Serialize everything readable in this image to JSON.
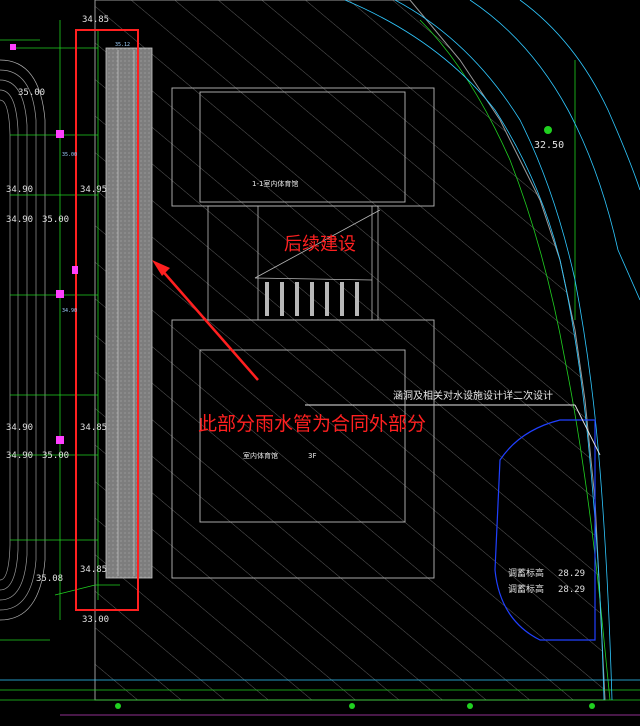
{
  "annotations": {
    "red_note": "此部分雨水管为合同外部分",
    "future_build": "后续建设",
    "culvert_note": "涵洞及相关对水设施设计详二次设计"
  },
  "building_labels": {
    "upper": "1-1室内体育馆",
    "lower": "室内体育馆",
    "floors": "3F"
  },
  "elevations": {
    "track_top_left": "35.00",
    "left_a": "34.90",
    "left_b": "35.00",
    "left_c": "34.90",
    "left_d": "35.00",
    "left_e": "35.00",
    "strip_top": "34.85",
    "strip_upper_mid": "34.95",
    "strip_lower_mid": "34.85",
    "strip_bottom": "34.85",
    "bottom_a": "35.08",
    "bottom_b": "33.00",
    "road_right": "32.50",
    "small_a": "35.12",
    "small_b": "35.00",
    "small_c": "34.90"
  },
  "pond_labels": {
    "upper": "调蓄标高",
    "lower": "调蓄标高",
    "upper_value": "28.29",
    "lower_value": "28.29"
  },
  "colors": {
    "background": "#000000",
    "highlight_box": "#ff2020",
    "hatch": "#5a5a5a",
    "pipe_green": "#20d020",
    "road_cyan": "#2fc8ff",
    "pond_blue": "#2040ff",
    "building_outline": "#b8b8b8",
    "gray_strip": "#8c8c8c"
  }
}
